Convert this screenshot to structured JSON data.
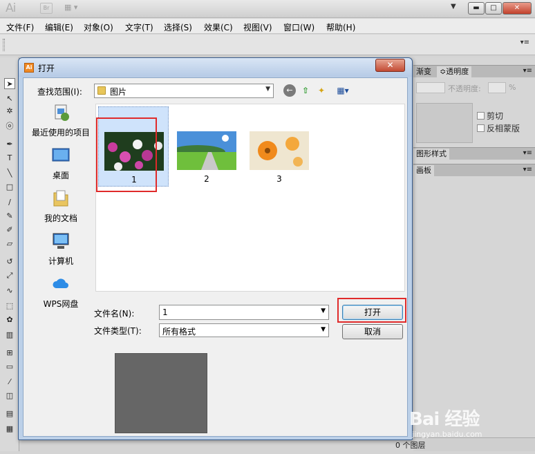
{
  "app": {
    "logo": "Ai",
    "bridge": "Br",
    "controls": {
      "minimize": "▬",
      "maximize": "□",
      "close": "✕"
    }
  },
  "menubar": [
    "文件(F)",
    "编辑(E)",
    "对象(O)",
    "文字(T)",
    "选择(S)",
    "效果(C)",
    "视图(V)",
    "窗口(W)",
    "帮助(H)"
  ],
  "panels": {
    "transparency": {
      "tabs": [
        "渐变",
        "≎透明度"
      ],
      "opacity_label": "不透明度:",
      "opacity_unit": "%",
      "clip_label": "剪切",
      "invert_mask_label": "反相蒙版"
    },
    "graphic_styles_tab": "图形样式",
    "artboard_tab": "画板",
    "layers_count": "0 个图层"
  },
  "dialog": {
    "title": "打开",
    "close": "✕",
    "lookin_label": "查找范围(I):",
    "lookin_value": "图片",
    "places": [
      {
        "label": "最近使用的项目",
        "icon": "recent-items-icon"
      },
      {
        "label": "桌面",
        "icon": "desktop-icon"
      },
      {
        "label": "我的文档",
        "icon": "documents-icon"
      },
      {
        "label": "计算机",
        "icon": "computer-icon"
      },
      {
        "label": "WPS网盘",
        "icon": "cloud-drive-icon"
      }
    ],
    "files": [
      {
        "name": "1",
        "selected": true
      },
      {
        "name": "2",
        "selected": false
      },
      {
        "name": "3",
        "selected": false
      }
    ],
    "filename_label": "文件名(N):",
    "filename_value": "1",
    "filetype_label": "文件类型(T):",
    "filetype_value": "所有格式",
    "open_button": "打开",
    "cancel_button": "取消"
  },
  "watermark": {
    "logo": "Bai 经验",
    "url": "jingyan.baidu.com"
  }
}
